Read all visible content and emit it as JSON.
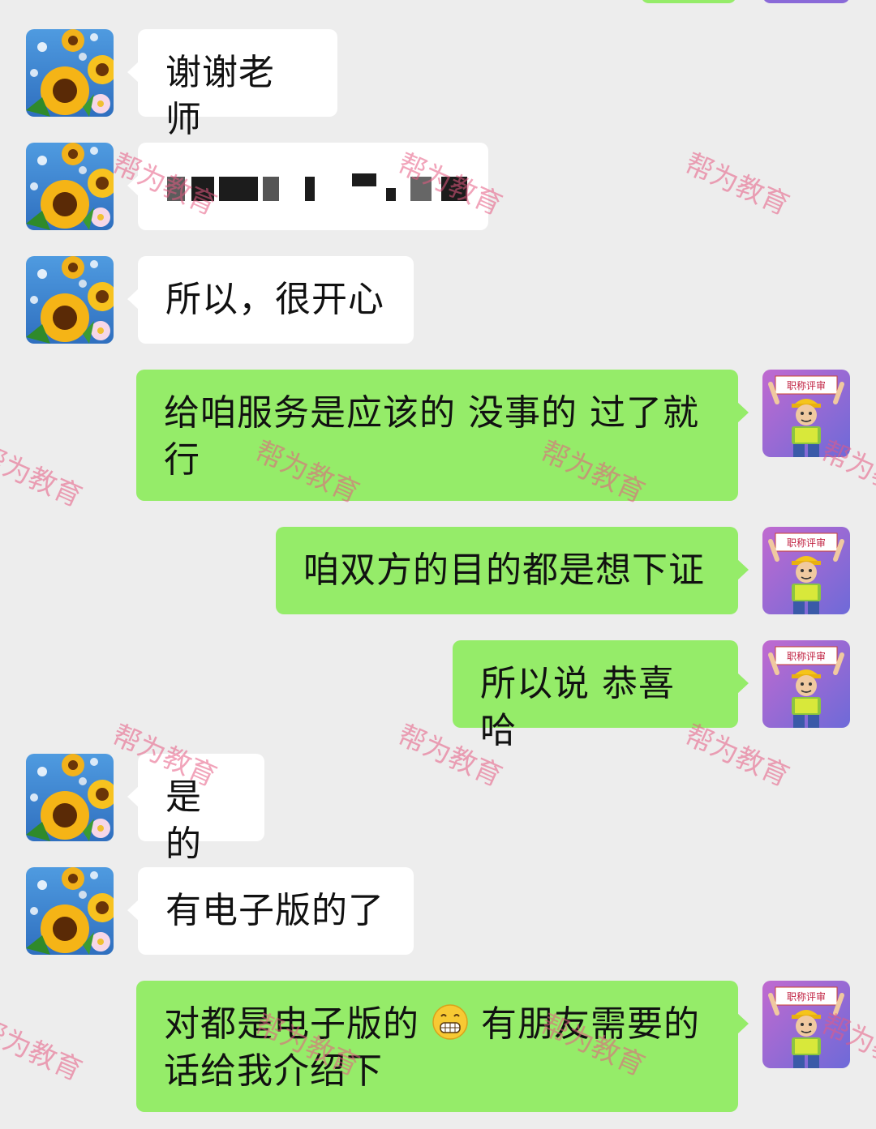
{
  "messages": [
    {
      "side": "in",
      "text": "谢谢老师"
    },
    {
      "side": "in",
      "text": "",
      "redacted": true
    },
    {
      "side": "in",
      "text": "所以，很开心"
    },
    {
      "side": "out",
      "line1": "给咱服务是应该的 没事的 过了就",
      "line2": "行"
    },
    {
      "side": "out",
      "text": "咱双方的目的都是想下证"
    },
    {
      "side": "out",
      "text": "所以说 恭喜哈"
    },
    {
      "side": "in",
      "text": "是的"
    },
    {
      "side": "in",
      "text": "有电子版的了"
    },
    {
      "side": "out",
      "line1a": "对都是电子版的",
      "emoji": "grinning-face-emoji",
      "line1b": "有朋友需要的",
      "line2": "话给我介绍下"
    }
  ],
  "avatars": {
    "customer": {
      "icon": "sunflower-avatar-icon"
    },
    "agent": {
      "icon": "worker-avatar-icon",
      "sign": "职称评审"
    }
  },
  "watermark": "帮为教育",
  "colors": {
    "background": "#ededed",
    "incoming_bubble": "#ffffff",
    "outgoing_bubble": "#95ec69",
    "watermark": "#e65a82"
  }
}
